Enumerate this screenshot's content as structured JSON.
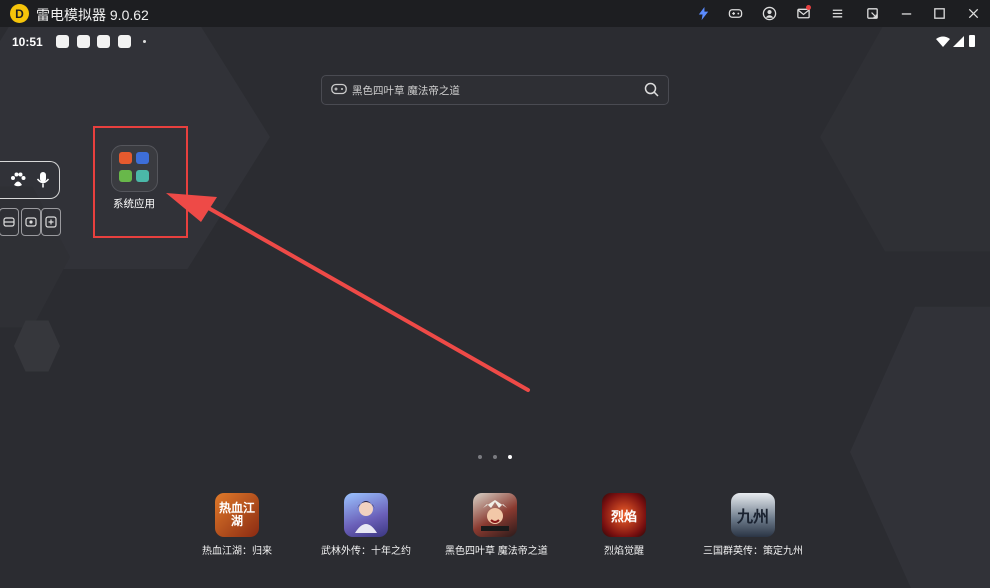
{
  "titlebar": {
    "logo_letter": "D",
    "app_title": "雷电模拟器 9.0.62",
    "accent_color": "#f5c40a",
    "buttons": [
      "lightning-icon",
      "gamepad-icon",
      "user-icon",
      "mail-icon",
      "menu-icon",
      "window-icon",
      "minimize-icon",
      "maximize-icon",
      "close-icon"
    ]
  },
  "statusbar": {
    "time": "10:51"
  },
  "search": {
    "text": "黑色四叶草 魔法帝之道"
  },
  "folder": {
    "label": "系统应用",
    "mini_colors": [
      "#e55a2e",
      "#3d6ed8",
      "#68b84a",
      "#4bb8a8"
    ]
  },
  "sidebar": {
    "icons": [
      "paw-icon",
      "mic-icon",
      "collapse-icon",
      "record-icon",
      "add-icon"
    ]
  },
  "pager": {
    "count": 3,
    "active": 2
  },
  "dock": [
    {
      "label": "热血江湖：归来",
      "glyph": "热血江湖",
      "color": "#c4581e"
    },
    {
      "label": "武林外传：十年之约",
      "glyph": "",
      "color": "#6b8ad8"
    },
    {
      "label": "黑色四叶草 魔法帝之道",
      "glyph": "",
      "color": "#a23a2e"
    },
    {
      "label": "烈焰觉醒",
      "glyph": "烈焰",
      "color": "#9a2020"
    },
    {
      "label": "三国群英传：策定九州",
      "glyph": "九州",
      "color": "#2d3848"
    }
  ],
  "annotation_color": "#e8403e"
}
